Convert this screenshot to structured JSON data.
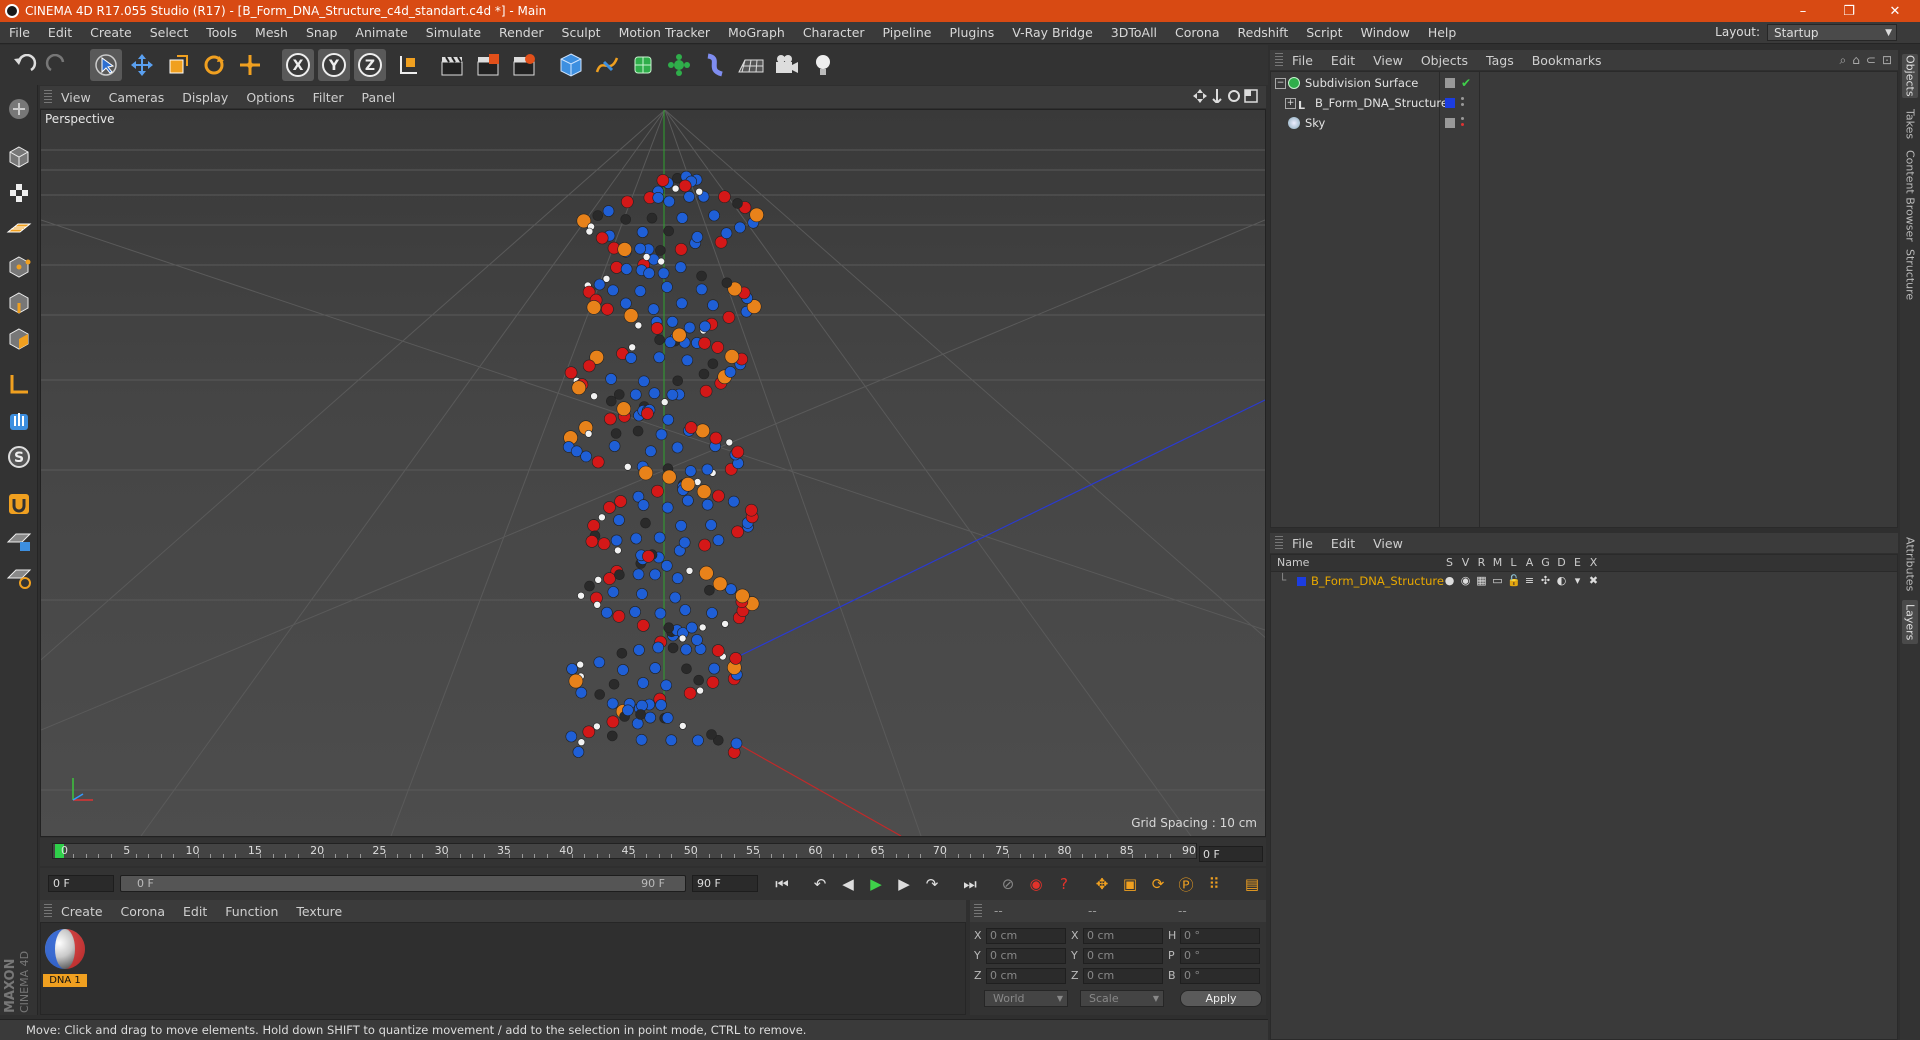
{
  "app": {
    "title": "CINEMA 4D R17.055 Studio (R17) - [B_Form_DNA_Structure_c4d_standart.c4d *] - Main",
    "window_controls": [
      "–",
      "❐",
      "✕"
    ]
  },
  "menubar": {
    "items": [
      "File",
      "Edit",
      "Create",
      "Select",
      "Tools",
      "Mesh",
      "Snap",
      "Animate",
      "Simulate",
      "Render",
      "Sculpt",
      "Motion Tracker",
      "MoGraph",
      "Character",
      "Pipeline",
      "Plugins",
      "V-Ray Bridge",
      "3DToAll",
      "Corona",
      "Redshift",
      "Script",
      "Window",
      "Help"
    ],
    "layout_label": "Layout:",
    "layout_value": "Startup"
  },
  "toolbar": {
    "axis_x": "X",
    "axis_y": "Y",
    "axis_z": "Z"
  },
  "viewport": {
    "menu": [
      "View",
      "Cameras",
      "Display",
      "Options",
      "Filter",
      "Panel"
    ],
    "camera": "Perspective",
    "grid_spacing": "Grid Spacing : 10 cm"
  },
  "timeline": {
    "ticks": [
      "0",
      "5",
      "10",
      "15",
      "20",
      "25",
      "30",
      "35",
      "40",
      "45",
      "50",
      "55",
      "60",
      "65",
      "70",
      "75",
      "80",
      "85",
      "90"
    ],
    "current_frame": "0 F",
    "start_field": "0 F",
    "range_start": "0 F",
    "range_end": "90 F",
    "end_field": "90 F"
  },
  "materials": {
    "menu": [
      "Create",
      "Corona",
      "Edit",
      "Function",
      "Texture"
    ],
    "items": [
      {
        "name": "DNA 1"
      }
    ]
  },
  "coordinates": {
    "header": [
      "--",
      "--",
      "--"
    ],
    "rows": [
      {
        "l1": "X",
        "v1": "0 cm",
        "l2": "X",
        "v2": "0 cm",
        "l3": "H",
        "v3": "0 °"
      },
      {
        "l1": "Y",
        "v1": "0 cm",
        "l2": "Y",
        "v2": "0 cm",
        "l3": "P",
        "v3": "0 °"
      },
      {
        "l1": "Z",
        "v1": "0 cm",
        "l2": "Z",
        "v2": "0 cm",
        "l3": "B",
        "v3": "0 °"
      }
    ],
    "mode": "World",
    "size_mode": "Scale",
    "apply": "Apply"
  },
  "status": {
    "text": "Move: Click and drag to move elements. Hold down SHIFT to quantize movement / add to the selection in point mode, CTRL to remove."
  },
  "objects": {
    "menu": [
      "File",
      "Edit",
      "View",
      "Objects",
      "Tags",
      "Bookmarks"
    ],
    "items": [
      {
        "name": "Subdivision Surface"
      },
      {
        "name": "B_Form_DNA_Structure"
      },
      {
        "name": "Sky"
      }
    ]
  },
  "layers": {
    "menu": [
      "File",
      "Edit",
      "View"
    ],
    "name_header": "Name",
    "flags": [
      "S",
      "V",
      "R",
      "M",
      "L",
      "A",
      "G",
      "D",
      "E",
      "X"
    ],
    "items": [
      {
        "name": "B_Form_DNA_Structure",
        "color": "#1c3de0"
      }
    ]
  },
  "side_tabs": [
    "Objects",
    "Takes",
    "Content Browser",
    "Structure",
    "Attributes",
    "Layers"
  ],
  "colors": {
    "accent": "#d84a13",
    "layer_name": "#e8a800",
    "selection": "#e8a800"
  }
}
